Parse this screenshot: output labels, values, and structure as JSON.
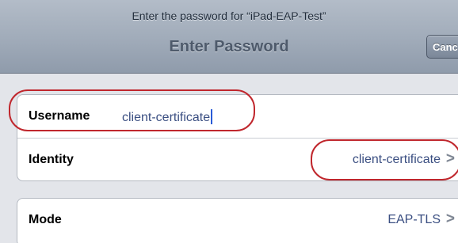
{
  "header": {
    "prompt": "Enter the password for “iPad-EAP-Test”",
    "title": "Enter Password",
    "cancel_label": "Canc"
  },
  "form": {
    "username": {
      "label": "Username",
      "value": "client-certificate"
    },
    "identity": {
      "label": "Identity",
      "value": "client-certificate"
    },
    "mode": {
      "label": "Mode",
      "value": "EAP-TLS"
    }
  },
  "icons": {
    "disclosure": "chevron-right-icon",
    "disclosure_glyph": ">"
  },
  "colors": {
    "annotation": "#c0272d",
    "value_text": "#3b4f82",
    "cursor": "#2a5bd7"
  }
}
